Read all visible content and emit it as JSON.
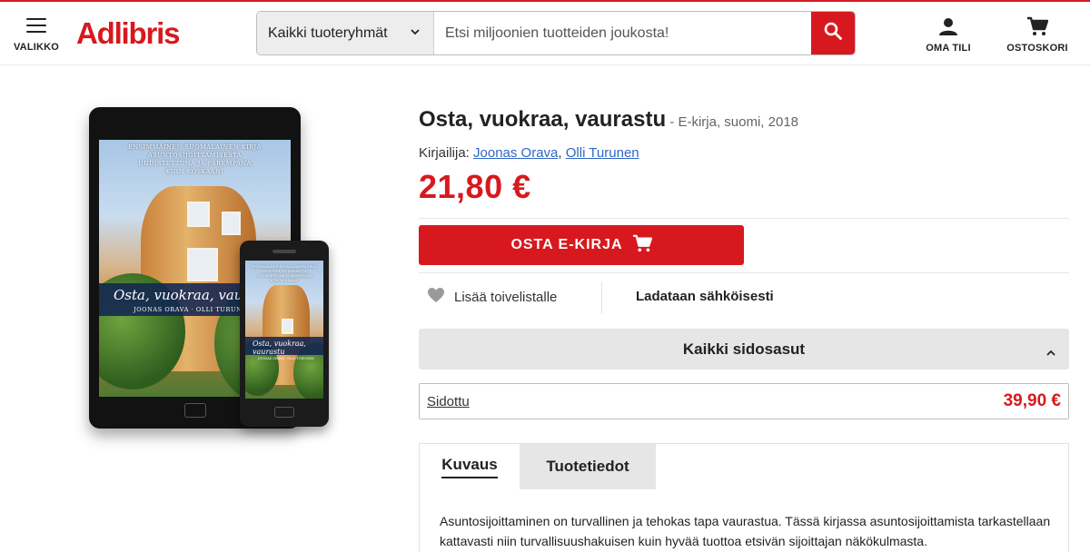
{
  "header": {
    "menu_label": "VALIKKO",
    "logo": "Adlibris",
    "category_select": "Kaikki tuoteryhmät",
    "search_placeholder": "Etsi miljoonien tuotteiden joukosta!",
    "account_label": "OMA TILI",
    "cart_label": "OSTOSKORI"
  },
  "cover": {
    "top_line_1": "ENSIMMÄINEN SUOMALAINEN KIRJA",
    "top_line_2": "ASUNTOSIJOITTAMISESTA",
    "top_line_3": "UUDISTETTUNA JA PAREMPANA",
    "top_line_4": "KUIN KOSKAAN!",
    "tablet_title": "Osta, vuokraa, vaur",
    "tablet_authors": "JOONAS ORAVA · OLLI TURUNEN",
    "phone_title": "Osta, vuokraa, vaurastu",
    "phone_authors": "JOONAS ORAVA · OLLI TURUNEN"
  },
  "product": {
    "title": "Osta, vuokraa, vaurastu",
    "subtitle": " - E-kirja, suomi, 2018",
    "authors_prefix": "Kirjailija: ",
    "author_1": "Joonas Orava",
    "author_sep": ", ",
    "author_2": "Olli Turunen",
    "price": "21,80 €",
    "buy_label": "OSTA E-KIRJA",
    "wishlist_label": "Lisää toivelistalle",
    "delivery_label": "Ladataan sähköisesti",
    "bindings_label": "Kaikki sidosasut",
    "binding_name": "Sidottu",
    "binding_price": "39,90 €"
  },
  "tabs": {
    "items": [
      {
        "label": "Kuvaus"
      },
      {
        "label": "Tuotetiedot"
      }
    ],
    "description": "Asuntosijoittaminen on turvallinen ja tehokas tapa vaurastua. Tässä kirjassa asuntosijoittamista tarkastellaan kattavasti niin turvallisuushakuisen kuin hyvää tuottoa etsivän sijoittajan näkökulmasta."
  },
  "colors": {
    "brand_red": "#d7191f",
    "link_blue": "#2f68c4"
  },
  "icons": [
    "hamburger-icon",
    "chevron-down-icon",
    "search-icon",
    "user-icon",
    "cart-icon",
    "heart-icon",
    "chevron-up-icon"
  ]
}
